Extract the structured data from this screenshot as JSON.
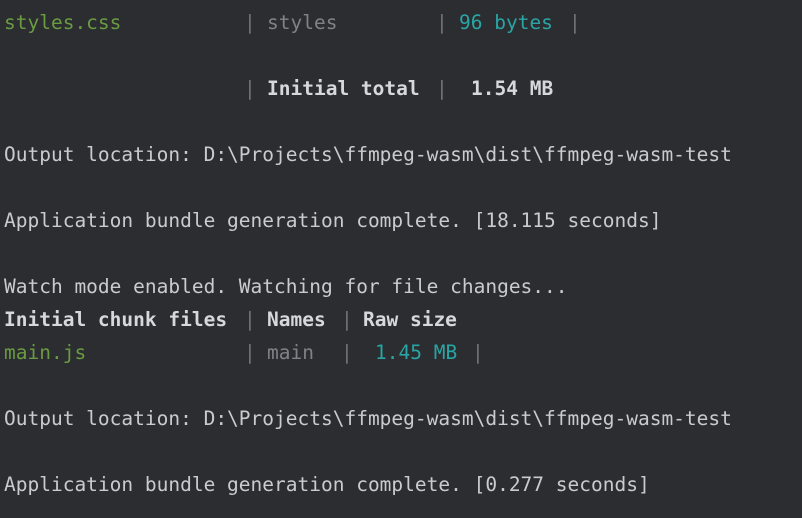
{
  "terminal": {
    "row_styles": {
      "file": "styles.css",
      "sep1": "|",
      "name": "styles",
      "sep2": "|",
      "size": "96 bytes",
      "sep3": "|"
    },
    "row_total": {
      "sep1": "|",
      "label": "Initial total",
      "sep2": "|",
      "size": "1.54 MB"
    },
    "output_location_1": "Output location: D:\\Projects\\ffmpeg-wasm\\dist\\ffmpeg-wasm-test",
    "bundle_complete_1": "Application bundle generation complete. [18.115 seconds]",
    "watch_mode": "Watch mode enabled. Watching for file changes...",
    "table_header": {
      "col1": "Initial chunk files",
      "sep1": "|",
      "col2": "Names",
      "sep2": "|",
      "col3": "Raw size"
    },
    "row_main": {
      "file": "main.js",
      "sep1": "|",
      "name": "main",
      "sep2": "|",
      "size": "1.45 MB",
      "sep3": "|"
    },
    "output_location_2": "Output location: D:\\Projects\\ffmpeg-wasm\\dist\\ffmpeg-wasm-test",
    "bundle_complete_2": "Application bundle generation complete. [0.277 seconds]"
  }
}
